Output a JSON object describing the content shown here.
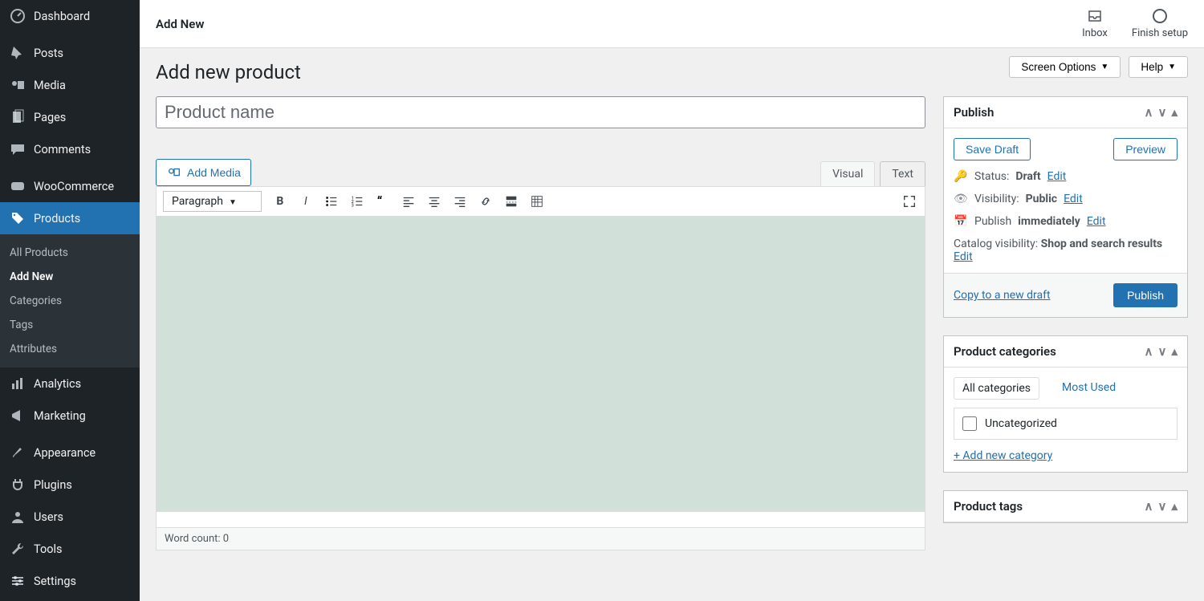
{
  "sidebar": {
    "items": [
      {
        "label": "Dashboard",
        "icon": "dashboard"
      },
      {
        "label": "Posts",
        "icon": "pin"
      },
      {
        "label": "Media",
        "icon": "media"
      },
      {
        "label": "Pages",
        "icon": "pages"
      },
      {
        "label": "Comments",
        "icon": "comments"
      },
      {
        "label": "WooCommerce",
        "icon": "woocommerce"
      },
      {
        "label": "Products",
        "icon": "products",
        "active": true
      },
      {
        "label": "Analytics",
        "icon": "analytics"
      },
      {
        "label": "Marketing",
        "icon": "marketing"
      },
      {
        "label": "Appearance",
        "icon": "appearance"
      },
      {
        "label": "Plugins",
        "icon": "plugins"
      },
      {
        "label": "Users",
        "icon": "users"
      },
      {
        "label": "Tools",
        "icon": "tools"
      },
      {
        "label": "Settings",
        "icon": "settings"
      }
    ],
    "submenu": [
      "All Products",
      "Add New",
      "Categories",
      "Tags",
      "Attributes"
    ],
    "submenu_active_index": 1
  },
  "topbar": {
    "title": "Add New",
    "inbox_label": "Inbox",
    "finish_label": "Finish setup"
  },
  "page": {
    "screen_options_label": "Screen Options",
    "help_label": "Help",
    "heading": "Add new product",
    "title_placeholder": "Product name"
  },
  "editor": {
    "add_media_label": "Add Media",
    "tab_visual": "Visual",
    "tab_text": "Text",
    "format_selector": "Paragraph",
    "word_count_label": "Word count:",
    "word_count_value": "0"
  },
  "publish": {
    "box_title": "Publish",
    "save_draft": "Save Draft",
    "preview": "Preview",
    "status_label": "Status:",
    "status_value": "Draft",
    "visibility_label": "Visibility:",
    "visibility_value": "Public",
    "publish_label": "Publish",
    "publish_value": "immediately",
    "catalog_label": "Catalog visibility:",
    "catalog_value": "Shop and search results",
    "edit": "Edit",
    "copy_draft": "Copy to a new draft",
    "publish_button": "Publish"
  },
  "categories": {
    "box_title": "Product categories",
    "tab_all": "All categories",
    "tab_most_used": "Most Used",
    "items": [
      "Uncategorized"
    ],
    "add_new": "+ Add new category"
  },
  "tags": {
    "box_title": "Product tags"
  }
}
